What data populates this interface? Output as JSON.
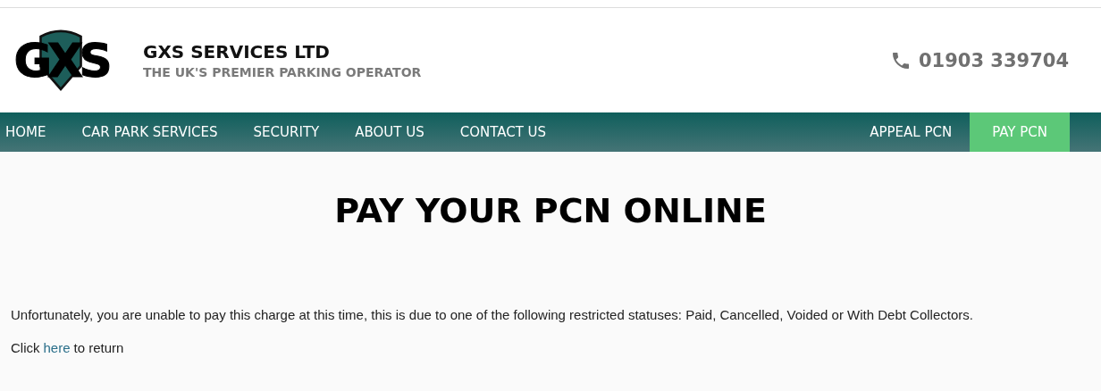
{
  "header": {
    "logo": "GXS",
    "company": "GXS SERVICES LTD",
    "tagline": "THE UK'S PREMIER PARKING OPERATOR",
    "phone": "01903 339704"
  },
  "nav": {
    "left": [
      {
        "label": "HOME",
        "selected": false
      },
      {
        "label": "CAR PARK SERVICES",
        "selected": false
      },
      {
        "label": "SECURITY",
        "selected": false
      },
      {
        "label": "ABOUT US",
        "selected": false
      },
      {
        "label": "CONTACT US",
        "selected": false
      }
    ],
    "right": [
      {
        "label": "APPEAL PCN",
        "selected": false
      },
      {
        "label": "PAY PCN",
        "selected": true
      }
    ]
  },
  "main": {
    "heading": "PAY YOUR PCN ONLINE",
    "message": "Unfortunately, you are unable to pay this charge at this time, this is due to one of the following restricted statuses: Paid, Cancelled, Voided or With Debt Collectors.",
    "return_prefix": "Click",
    "return_link": "here",
    "return_suffix": "to return"
  }
}
